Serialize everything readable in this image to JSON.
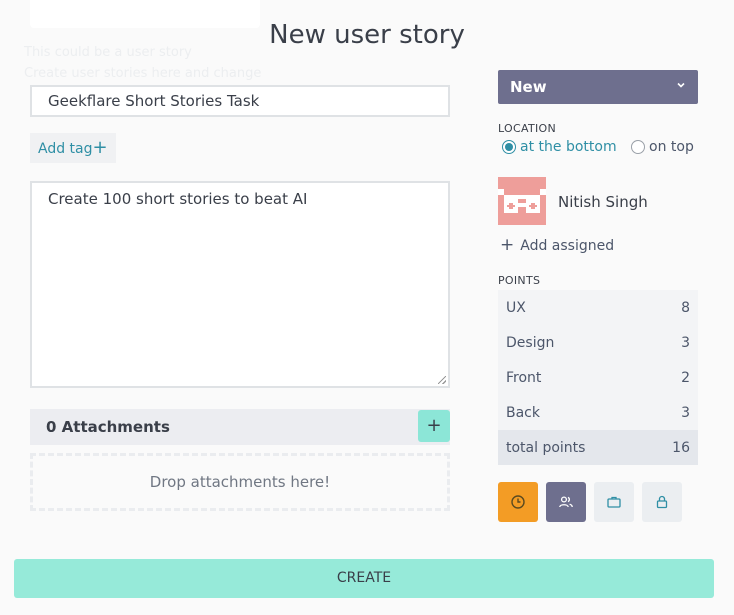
{
  "dialog": {
    "title": "New user story",
    "ghost_lines": [
      "This could be a user story",
      "Create user stories here and change"
    ]
  },
  "form": {
    "subject_value": "Geekflare Short Stories Task",
    "add_tag_label": "Add tag",
    "description_value": "Create 100 short stories to beat AI",
    "attachments_label": "0 Attachments",
    "attachments_add": "+",
    "drop_label": "Drop attachments here!"
  },
  "sidebar": {
    "status_value": "New",
    "location_label": "LOCATION",
    "location_options": [
      "at the bottom",
      "on top"
    ],
    "location_selected": "at the bottom",
    "assigned_name": "Nitish Singh",
    "add_assigned_label": "Add assigned",
    "points_label": "POINTS",
    "points": [
      {
        "role": "UX",
        "value": "8"
      },
      {
        "role": "Design",
        "value": "3"
      },
      {
        "role": "Front",
        "value": "2"
      },
      {
        "role": "Back",
        "value": "3"
      }
    ],
    "total_label": "total points",
    "total_value": "16",
    "action_icons": [
      "clock-icon",
      "users-icon",
      "briefcase-icon",
      "lock-icon"
    ]
  },
  "footer": {
    "create_label": "CREATE"
  },
  "colors": {
    "status_bg": "#6e6f8e",
    "accent": "#2f8fa5",
    "create_bg": "#96ead9",
    "clock_button": "#f39c25",
    "avatar_bg": "#ee9e9a"
  }
}
